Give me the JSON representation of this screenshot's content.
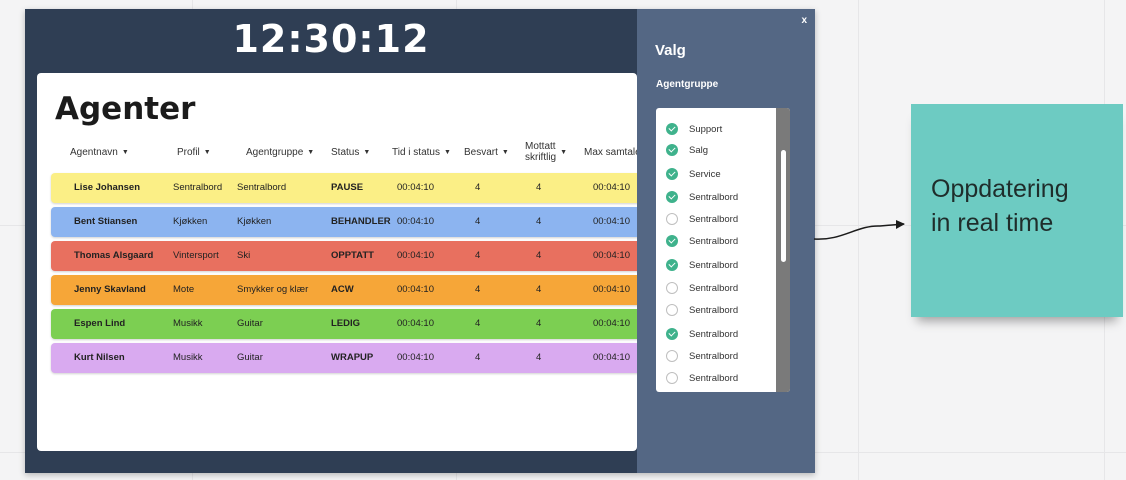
{
  "dashboard": {
    "clock": "12:30:12",
    "title": "Agenter",
    "columns": [
      {
        "label": "Agentnavn",
        "sort": true
      },
      {
        "label": "Profil",
        "sort": true
      },
      {
        "label": "Agentgruppe",
        "sort": true
      },
      {
        "label": "Status",
        "sort": true
      },
      {
        "label": "Tid i status",
        "sort": true
      },
      {
        "label": "Besvart",
        "sort": true
      },
      {
        "label": "Mottatt\nskriftlig",
        "sort": true
      },
      {
        "label": "Max samtaletid",
        "sort": false
      }
    ],
    "rows": [
      {
        "name": "Lise Johansen",
        "profil": "Sentralbord",
        "gruppe": "Sentralbord",
        "status": "PAUSE",
        "tid": "00:04:10",
        "besvart": "4",
        "mottatt": "4",
        "max": "00:04:10",
        "color": "#fbef86"
      },
      {
        "name": "Bent Stiansen",
        "profil": "Kjøkken",
        "gruppe": "Kjøkken",
        "status": "BEHANDLER",
        "tid": "00:04:10",
        "besvart": "4",
        "mottatt": "4",
        "max": "00:04:10",
        "color": "#8cb4f0"
      },
      {
        "name": "Thomas Alsgaard",
        "profil": "Vintersport",
        "gruppe": "Ski",
        "status": "OPPTATT",
        "tid": "00:04:10",
        "besvart": "4",
        "mottatt": "4",
        "max": "00:04:10",
        "color": "#e8705f"
      },
      {
        "name": "Jenny Skavland",
        "profil": "Mote",
        "gruppe": "Smykker og klær",
        "status": "ACW",
        "tid": "00:04:10",
        "besvart": "4",
        "mottatt": "4",
        "max": "00:04:10",
        "color": "#f6a638"
      },
      {
        "name": "Espen Lind",
        "profil": "Musikk",
        "gruppe": "Guitar",
        "status": "LEDIG",
        "tid": "00:04:10",
        "besvart": "4",
        "mottatt": "4",
        "max": "00:04:10",
        "color": "#7ccf52"
      },
      {
        "name": "Kurt Nilsen",
        "profil": "Musikk",
        "gruppe": "Guitar",
        "status": "WRAPUP",
        "tid": "00:04:10",
        "besvart": "4",
        "mottatt": "4",
        "max": "00:04:10",
        "color": "#d9aaf0"
      }
    ]
  },
  "panel": {
    "close_label": "x",
    "title": "Valg",
    "subtitle": "Agentgruppe",
    "options": [
      {
        "label": "Support",
        "checked": true
      },
      {
        "label": "Salg",
        "checked": true
      },
      {
        "label": "Service",
        "checked": true
      },
      {
        "label": "Sentralbord",
        "checked": true
      },
      {
        "label": "Sentralbord",
        "checked": false
      },
      {
        "label": "Sentralbord",
        "checked": true
      },
      {
        "label": "Sentralbord",
        "checked": true
      },
      {
        "label": "Sentralbord",
        "checked": false
      },
      {
        "label": "Sentralbord",
        "checked": false
      },
      {
        "label": "Sentralbord",
        "checked": true
      },
      {
        "label": "Sentralbord",
        "checked": false
      },
      {
        "label": "Sentralbord",
        "checked": false
      }
    ]
  },
  "sticky_note": {
    "text": "Oppdatering\nin real time",
    "color": "#6dcbc2"
  },
  "icons": {
    "sort": "caret-down-icon",
    "checked": "check-circle-icon",
    "unchecked": "empty-circle-icon",
    "close": "close-icon",
    "connector": "curved-arrow-icon"
  }
}
